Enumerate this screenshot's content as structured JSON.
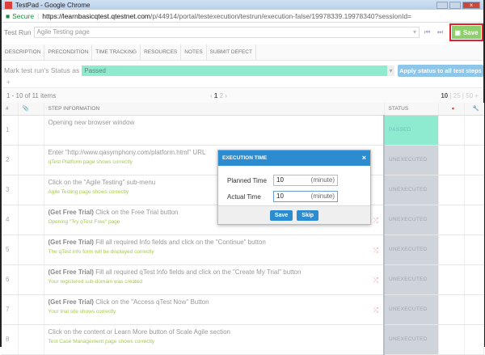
{
  "window": {
    "title": "TestPad - Google Chrome"
  },
  "address": {
    "secure": "Secure",
    "domain": "https://learnbasicqtest.qtestnet.com",
    "path": "/p/44914/portal/testexecution/testrun/execution-false/19978339.19978340?sessionId="
  },
  "run": {
    "label": "Test Run",
    "value": "Agile Testing page",
    "save": "Save"
  },
  "tabs": [
    "DESCRIPTION",
    "PRECONDITION",
    "TIME TRACKING",
    "RESOURCES",
    "NOTES",
    "SUBMIT DEFECT"
  ],
  "status": {
    "label": "Mark test run's Status as",
    "value": "Passed",
    "apply": "Apply status to all test steps",
    "color": "#8eebd0"
  },
  "pager": {
    "summary": "1 - 10 of 11 items",
    "current": "1",
    "next": "2",
    "size_current": "10",
    "size_25": "25",
    "size_50": "50"
  },
  "columns": {
    "num": "#",
    "step": "STEP INFORMATION",
    "status": "STATUS"
  },
  "rows": [
    {
      "num": "1",
      "prefix": "",
      "desc": "Opening new browser window",
      "expected": "",
      "status": "PASSED"
    },
    {
      "num": "2",
      "prefix": "",
      "desc": "Enter \"http://www.qasymphony.com/platform.html\" URL",
      "expected": "qTest Platform page shows correctly",
      "status": "UNEXECUTED"
    },
    {
      "num": "3",
      "prefix": "",
      "desc": "Click on the \"Agile Testing\" sub-menu",
      "expected": "Agile Testing page shows correctly",
      "status": "UNEXECUTED"
    },
    {
      "num": "4",
      "prefix": "(Get Free Trial)",
      "desc": " Click on the Free Trial button",
      "expected": "Opening \"Try qTest Free\" page",
      "status": "UNEXECUTED"
    },
    {
      "num": "5",
      "prefix": "(Get Free Trial)",
      "desc": " Fill all required Info fields and click on the \"Continue\" button",
      "expected": "The qTest info form will be displayed correctly",
      "status": "UNEXECUTED"
    },
    {
      "num": "6",
      "prefix": "(Get Free Trial)",
      "desc": " Fill all required qTest Info fields and click on the \"Create My Trial\" button",
      "expected": "Your registered sub-domain was created",
      "status": "UNEXECUTED"
    },
    {
      "num": "7",
      "prefix": "(Get Free Trial)",
      "desc": " Click on the \"Access qTest Now\" Button",
      "expected": "Your trial site shows correctly",
      "status": "UNEXECUTED"
    },
    {
      "num": "8",
      "prefix": "",
      "desc": "Click on the content or Learn More button of Scale Agile section",
      "expected": "Test Case Management page shows correctly",
      "status": "UNEXECUTED"
    }
  ],
  "dialog": {
    "title": "EXECUTION TIME",
    "planned_label": "Planned Time",
    "planned": "10",
    "actual_label": "Actual Time",
    "actual": "10",
    "unit": "(minute)",
    "save": "Save",
    "skip": "Skip"
  }
}
